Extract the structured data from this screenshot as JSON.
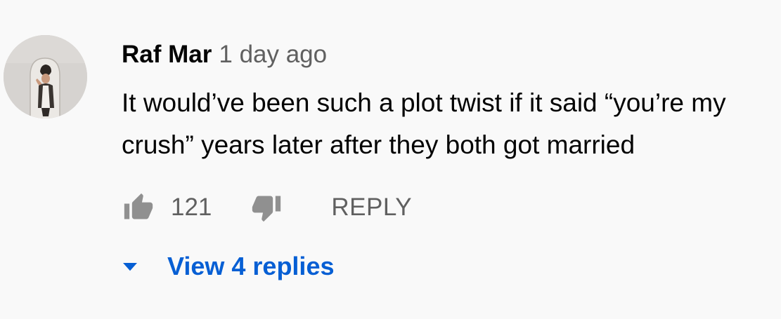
{
  "comment": {
    "author": "Raf Mar",
    "time": "1 day ago",
    "text": "It would’ve been such a plot twist if it said “you’re my crush” years later after they both got married",
    "like_count": "121",
    "reply_label": "REPLY",
    "view_replies_label": "View 4 replies"
  },
  "icons": {
    "like": "thumbs-up-icon",
    "dislike": "thumbs-down-icon",
    "expand": "caret-down-icon"
  },
  "colors": {
    "background": "#f9f9f9",
    "text_primary": "#030303",
    "text_secondary": "#606060",
    "link_blue": "#065fd4"
  }
}
